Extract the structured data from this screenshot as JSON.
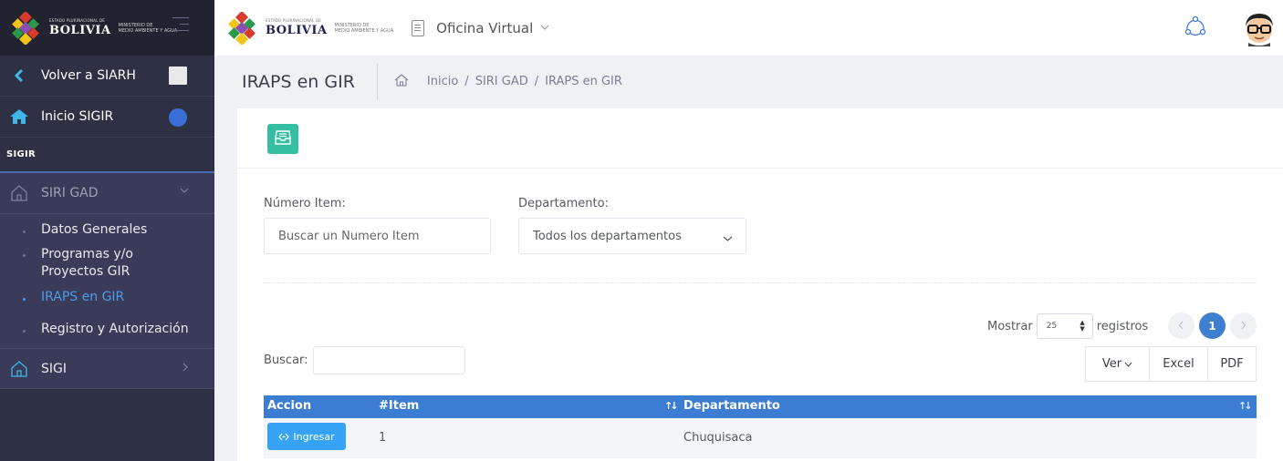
{
  "brand": {
    "country_small": "ESTADO PLURINACIONAL DE",
    "country": "BOLIVIA",
    "ministry_line1": "MINISTERIO DE",
    "ministry_line2": "MEDIO AMBIENTE Y AGUA"
  },
  "sidebar": {
    "back_label": "Volver a SIARH",
    "home_label": "Inicio SIGIR",
    "section_label": "SIGIR",
    "group_label": "SIRI GAD",
    "sub_items": [
      {
        "label": "Datos Generales"
      },
      {
        "label": "Programas y/o\nProyectos GIR"
      },
      {
        "label": "IRAPS en GIR"
      },
      {
        "label": "Registro y Autorización"
      }
    ],
    "sigi_label": "SIGI"
  },
  "header": {
    "office_label": "Oficina Virtual"
  },
  "page": {
    "title": "IRAPS en GIR",
    "breadcrumb": [
      "Inicio",
      "SIRI GAD",
      "IRAPS en GIR"
    ]
  },
  "filters": {
    "item_label": "Número Item:",
    "item_placeholder": "Buscar un Numero Item",
    "dept_label": "Departamento:",
    "dept_value": "Todos los departamentos"
  },
  "table_controls": {
    "show_label": "Mostrar",
    "page_size": "25",
    "records_label": "registros",
    "current_page": "1",
    "search_label": "Buscar:",
    "buttons": [
      "Ver",
      "Excel",
      "PDF"
    ]
  },
  "table": {
    "columns": [
      "Accion",
      "#Item",
      "Departamento"
    ],
    "rows": [
      {
        "action": "Ingresar",
        "item": "1",
        "department": "Chuquisaca"
      }
    ]
  },
  "colors": {
    "sidebar_bg": "#2e3043",
    "accent_blue": "#3b7dd2",
    "accent_teal": "#34bfa3",
    "button_blue": "#36a3f7"
  }
}
